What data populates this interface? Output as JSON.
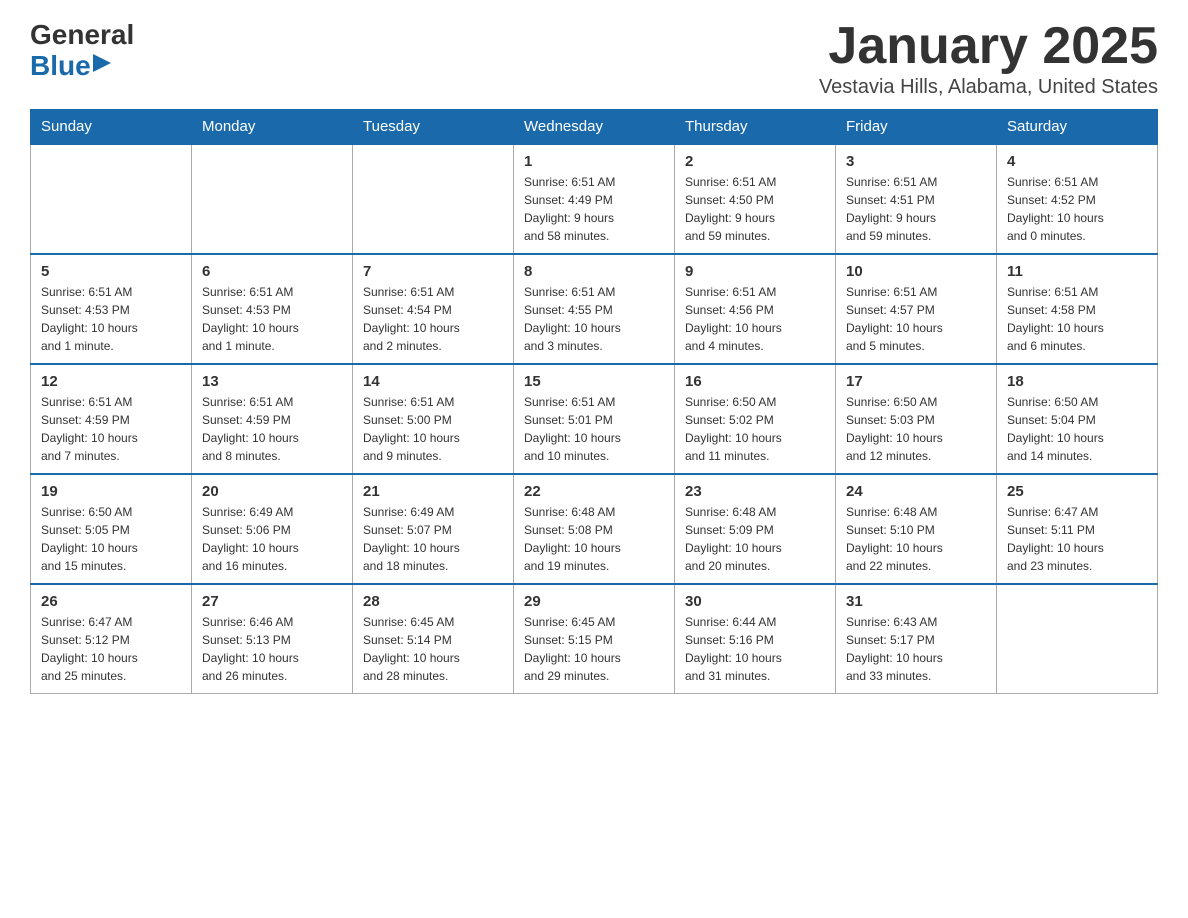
{
  "header": {
    "logo_general": "General",
    "logo_blue": "Blue",
    "month_title": "January 2025",
    "location": "Vestavia Hills, Alabama, United States"
  },
  "days_of_week": [
    "Sunday",
    "Monday",
    "Tuesday",
    "Wednesday",
    "Thursday",
    "Friday",
    "Saturday"
  ],
  "weeks": [
    [
      {
        "day": "",
        "info": ""
      },
      {
        "day": "",
        "info": ""
      },
      {
        "day": "",
        "info": ""
      },
      {
        "day": "1",
        "info": "Sunrise: 6:51 AM\nSunset: 4:49 PM\nDaylight: 9 hours\nand 58 minutes."
      },
      {
        "day": "2",
        "info": "Sunrise: 6:51 AM\nSunset: 4:50 PM\nDaylight: 9 hours\nand 59 minutes."
      },
      {
        "day": "3",
        "info": "Sunrise: 6:51 AM\nSunset: 4:51 PM\nDaylight: 9 hours\nand 59 minutes."
      },
      {
        "day": "4",
        "info": "Sunrise: 6:51 AM\nSunset: 4:52 PM\nDaylight: 10 hours\nand 0 minutes."
      }
    ],
    [
      {
        "day": "5",
        "info": "Sunrise: 6:51 AM\nSunset: 4:53 PM\nDaylight: 10 hours\nand 1 minute."
      },
      {
        "day": "6",
        "info": "Sunrise: 6:51 AM\nSunset: 4:53 PM\nDaylight: 10 hours\nand 1 minute."
      },
      {
        "day": "7",
        "info": "Sunrise: 6:51 AM\nSunset: 4:54 PM\nDaylight: 10 hours\nand 2 minutes."
      },
      {
        "day": "8",
        "info": "Sunrise: 6:51 AM\nSunset: 4:55 PM\nDaylight: 10 hours\nand 3 minutes."
      },
      {
        "day": "9",
        "info": "Sunrise: 6:51 AM\nSunset: 4:56 PM\nDaylight: 10 hours\nand 4 minutes."
      },
      {
        "day": "10",
        "info": "Sunrise: 6:51 AM\nSunset: 4:57 PM\nDaylight: 10 hours\nand 5 minutes."
      },
      {
        "day": "11",
        "info": "Sunrise: 6:51 AM\nSunset: 4:58 PM\nDaylight: 10 hours\nand 6 minutes."
      }
    ],
    [
      {
        "day": "12",
        "info": "Sunrise: 6:51 AM\nSunset: 4:59 PM\nDaylight: 10 hours\nand 7 minutes."
      },
      {
        "day": "13",
        "info": "Sunrise: 6:51 AM\nSunset: 4:59 PM\nDaylight: 10 hours\nand 8 minutes."
      },
      {
        "day": "14",
        "info": "Sunrise: 6:51 AM\nSunset: 5:00 PM\nDaylight: 10 hours\nand 9 minutes."
      },
      {
        "day": "15",
        "info": "Sunrise: 6:51 AM\nSunset: 5:01 PM\nDaylight: 10 hours\nand 10 minutes."
      },
      {
        "day": "16",
        "info": "Sunrise: 6:50 AM\nSunset: 5:02 PM\nDaylight: 10 hours\nand 11 minutes."
      },
      {
        "day": "17",
        "info": "Sunrise: 6:50 AM\nSunset: 5:03 PM\nDaylight: 10 hours\nand 12 minutes."
      },
      {
        "day": "18",
        "info": "Sunrise: 6:50 AM\nSunset: 5:04 PM\nDaylight: 10 hours\nand 14 minutes."
      }
    ],
    [
      {
        "day": "19",
        "info": "Sunrise: 6:50 AM\nSunset: 5:05 PM\nDaylight: 10 hours\nand 15 minutes."
      },
      {
        "day": "20",
        "info": "Sunrise: 6:49 AM\nSunset: 5:06 PM\nDaylight: 10 hours\nand 16 minutes."
      },
      {
        "day": "21",
        "info": "Sunrise: 6:49 AM\nSunset: 5:07 PM\nDaylight: 10 hours\nand 18 minutes."
      },
      {
        "day": "22",
        "info": "Sunrise: 6:48 AM\nSunset: 5:08 PM\nDaylight: 10 hours\nand 19 minutes."
      },
      {
        "day": "23",
        "info": "Sunrise: 6:48 AM\nSunset: 5:09 PM\nDaylight: 10 hours\nand 20 minutes."
      },
      {
        "day": "24",
        "info": "Sunrise: 6:48 AM\nSunset: 5:10 PM\nDaylight: 10 hours\nand 22 minutes."
      },
      {
        "day": "25",
        "info": "Sunrise: 6:47 AM\nSunset: 5:11 PM\nDaylight: 10 hours\nand 23 minutes."
      }
    ],
    [
      {
        "day": "26",
        "info": "Sunrise: 6:47 AM\nSunset: 5:12 PM\nDaylight: 10 hours\nand 25 minutes."
      },
      {
        "day": "27",
        "info": "Sunrise: 6:46 AM\nSunset: 5:13 PM\nDaylight: 10 hours\nand 26 minutes."
      },
      {
        "day": "28",
        "info": "Sunrise: 6:45 AM\nSunset: 5:14 PM\nDaylight: 10 hours\nand 28 minutes."
      },
      {
        "day": "29",
        "info": "Sunrise: 6:45 AM\nSunset: 5:15 PM\nDaylight: 10 hours\nand 29 minutes."
      },
      {
        "day": "30",
        "info": "Sunrise: 6:44 AM\nSunset: 5:16 PM\nDaylight: 10 hours\nand 31 minutes."
      },
      {
        "day": "31",
        "info": "Sunrise: 6:43 AM\nSunset: 5:17 PM\nDaylight: 10 hours\nand 33 minutes."
      },
      {
        "day": "",
        "info": ""
      }
    ]
  ]
}
